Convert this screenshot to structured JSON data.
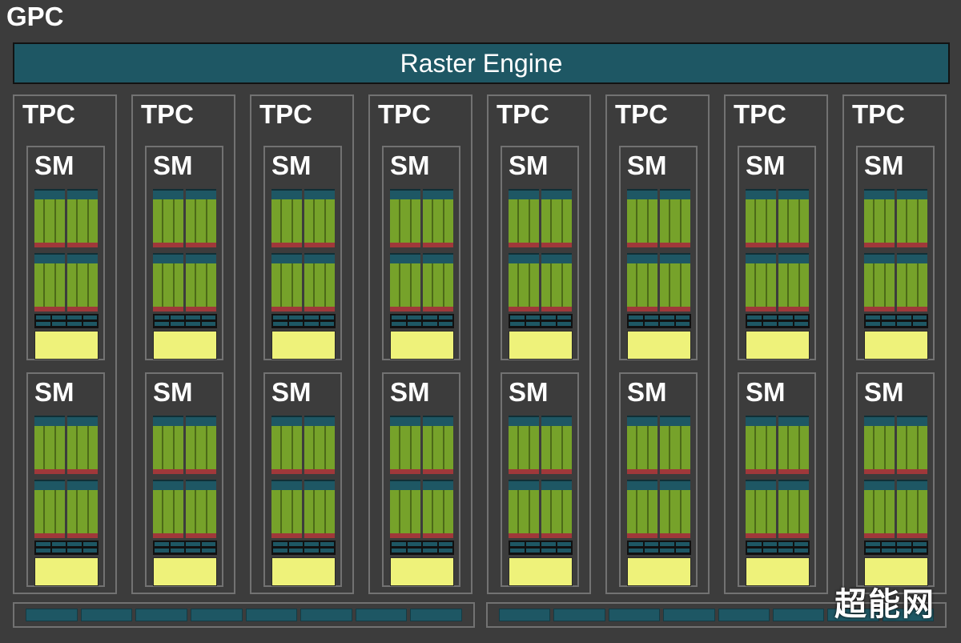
{
  "diagram": {
    "gpc_label": "GPC",
    "raster_label": "Raster Engine",
    "tpc_label": "TPC",
    "sm_label": "SM",
    "tpc_count": 8,
    "sm_per_tpc": 2,
    "watermark": "超能网",
    "colors": {
      "background": "#3c3c3c",
      "raster": "#1e5764",
      "cuda_cores": "#76a22a",
      "cache": "#eef27a",
      "accent_red": "#a0383a",
      "border": "#727272"
    }
  }
}
